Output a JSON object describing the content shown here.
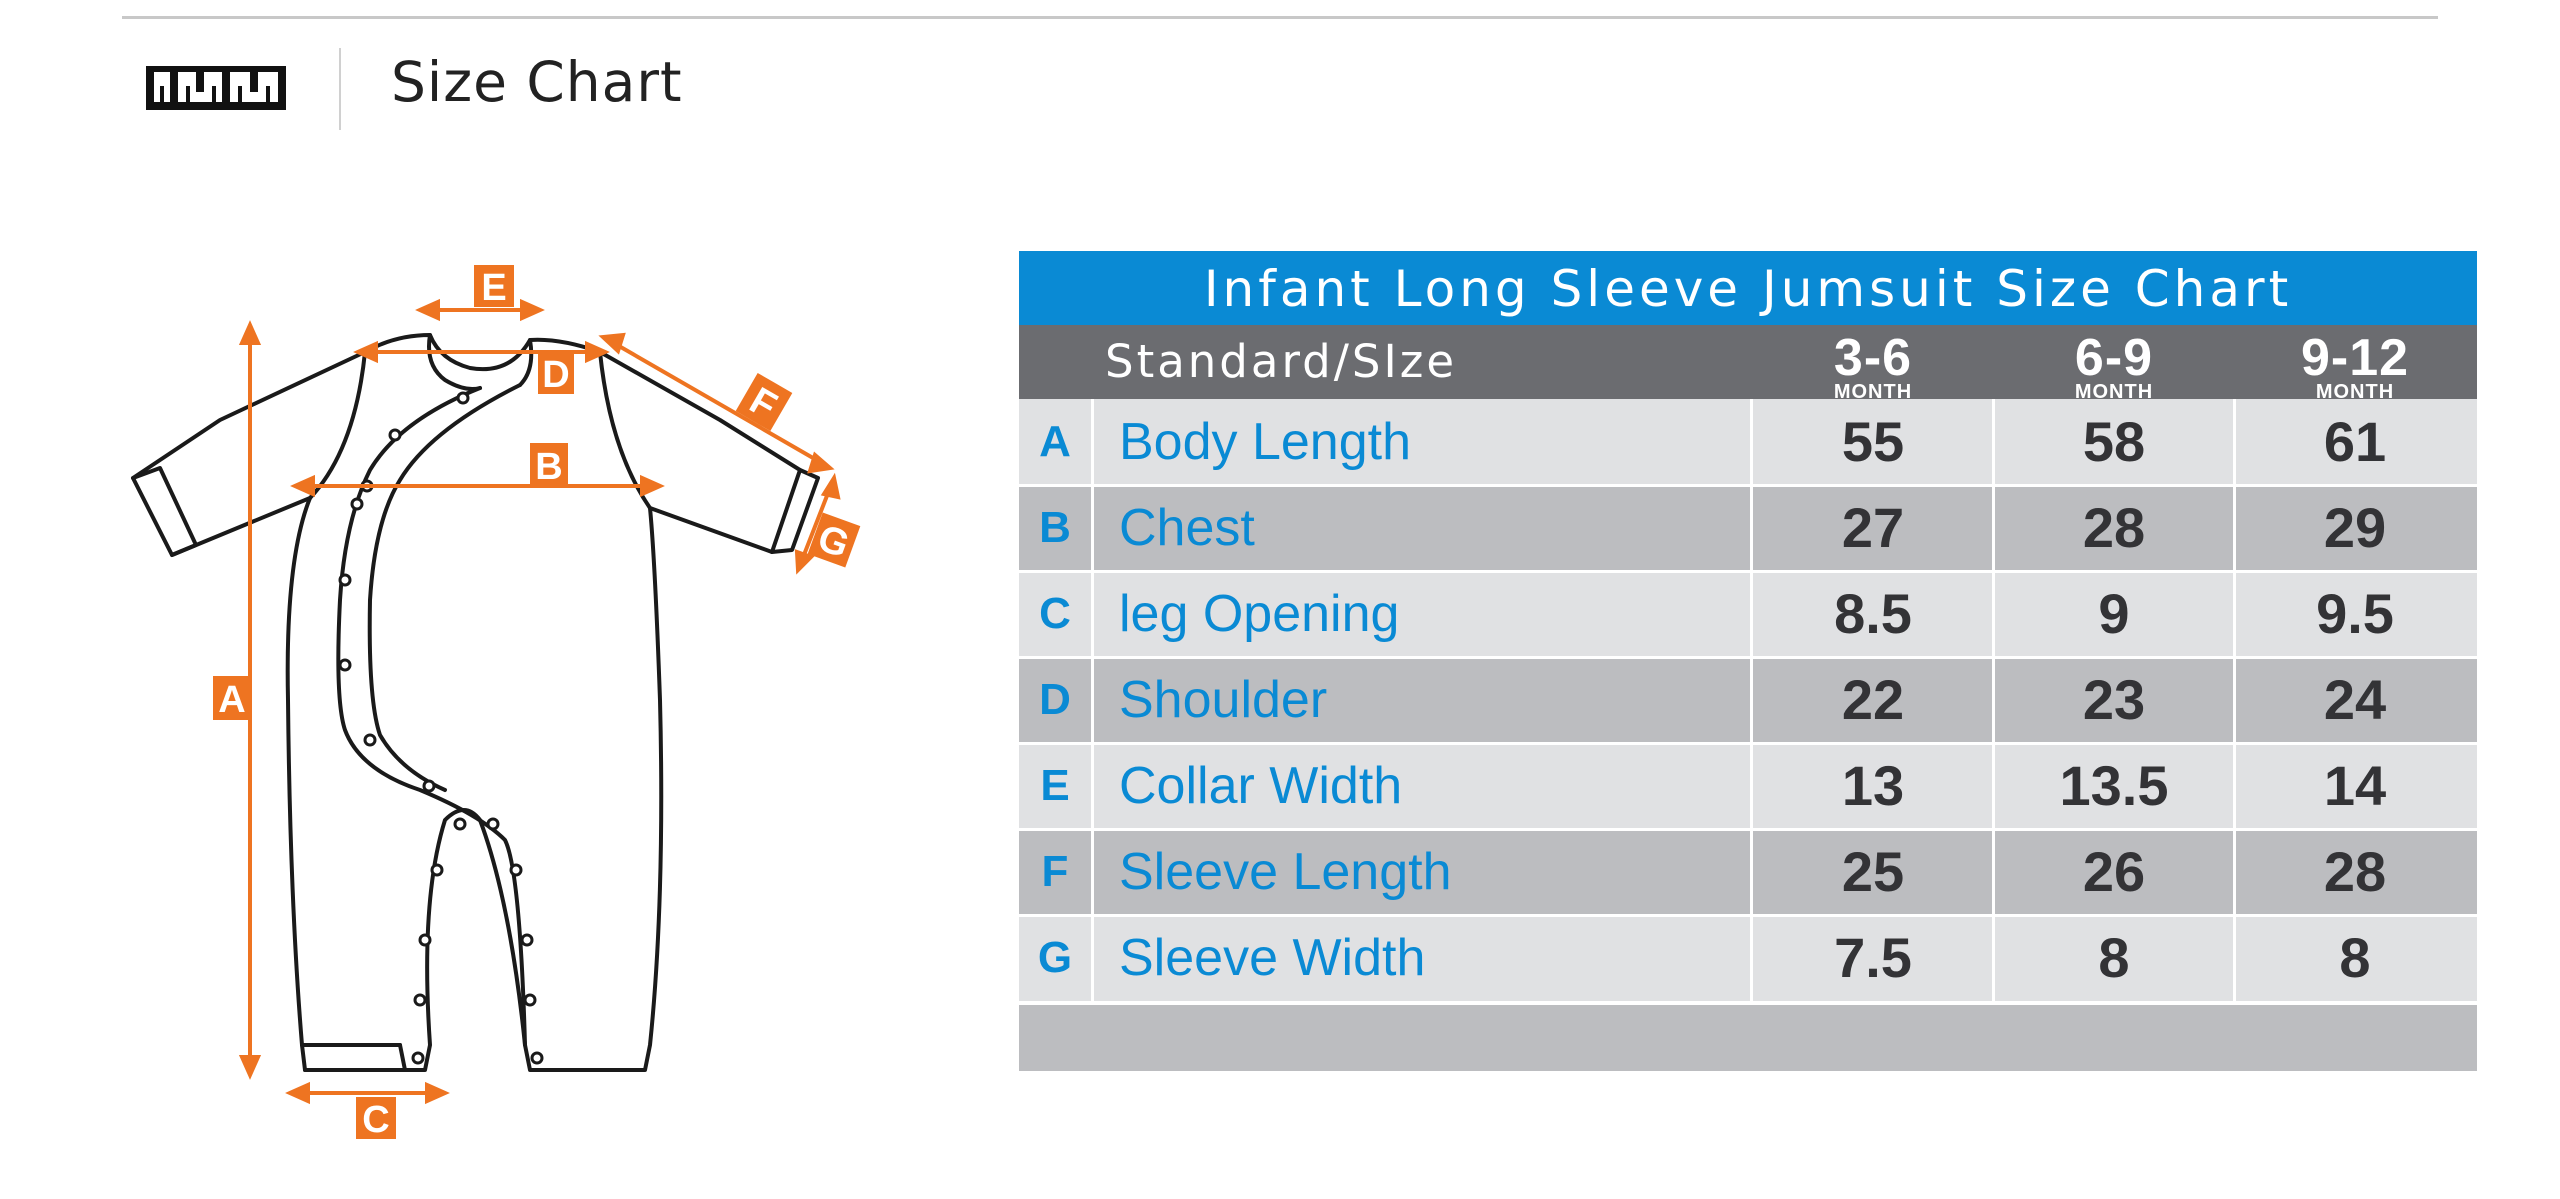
{
  "header": {
    "title": "Size Chart"
  },
  "icons": {
    "ruler": "ruler-icon"
  },
  "colors": {
    "accent_blue": "#0a8ad4",
    "header_gray": "#6b6c70",
    "row_light": "#e0e1e3",
    "row_dark": "#bcbdc0",
    "dimension_orange": "#ee7421"
  },
  "diagram": {
    "dimension_labels": [
      "A",
      "B",
      "C",
      "D",
      "E",
      "F",
      "G"
    ]
  },
  "table": {
    "title": "Infant Long Sleeve Jumsuit Size Chart",
    "standard_label": "Standard/SIze",
    "sizes": [
      {
        "range": "3-6",
        "unit": "MONTH"
      },
      {
        "range": "6-9",
        "unit": "MONTH"
      },
      {
        "range": "9-12",
        "unit": "MONTH"
      }
    ],
    "rows": [
      {
        "letter": "A",
        "name": "Body Length",
        "values": [
          "55",
          "58",
          "61"
        ]
      },
      {
        "letter": "B",
        "name": "Chest",
        "values": [
          "27",
          "28",
          "29"
        ]
      },
      {
        "letter": "C",
        "name": "leg Opening",
        "values": [
          "8.5",
          "9",
          "9.5"
        ]
      },
      {
        "letter": "D",
        "name": "Shoulder",
        "values": [
          "22",
          "23",
          "24"
        ]
      },
      {
        "letter": "E",
        "name": "Collar Width",
        "values": [
          "13",
          "13.5",
          "14"
        ]
      },
      {
        "letter": "F",
        "name": "Sleeve Length",
        "values": [
          "25",
          "26",
          "28"
        ]
      },
      {
        "letter": "G",
        "name": "Sleeve Width",
        "values": [
          "7.5",
          "8",
          "8"
        ]
      }
    ]
  }
}
